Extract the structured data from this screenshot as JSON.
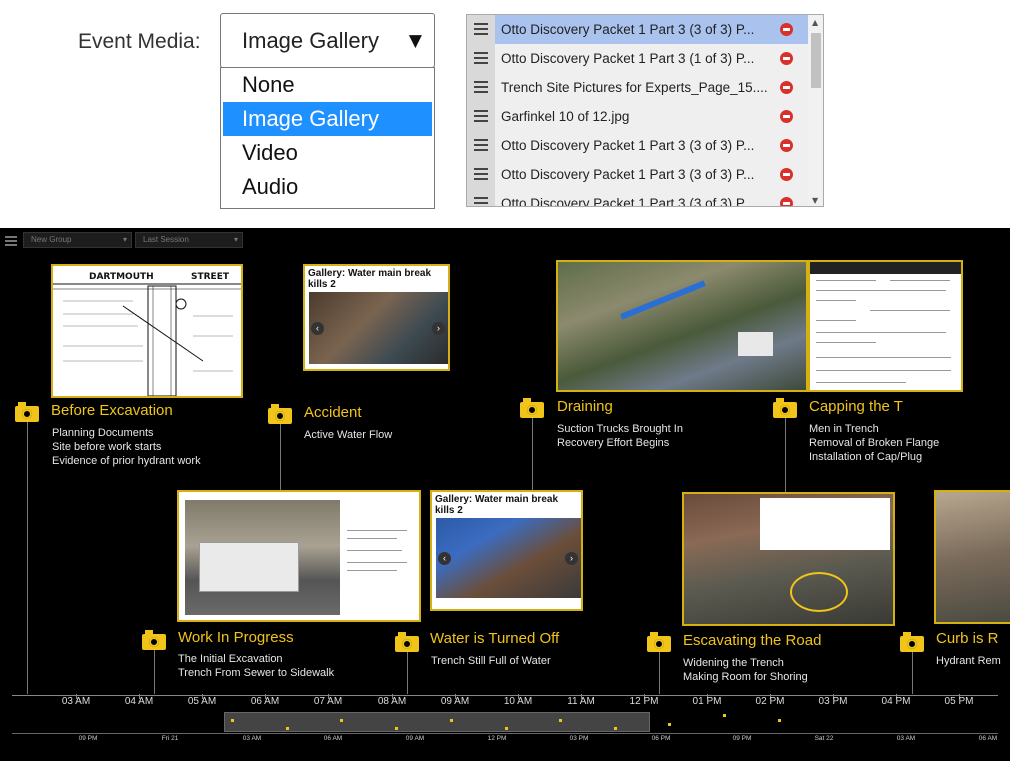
{
  "form": {
    "event_media_label": "Event Media:",
    "selected": "Image Gallery",
    "options": [
      "None",
      "Image Gallery",
      "Video",
      "Audio"
    ]
  },
  "media_list": [
    {
      "name": "Otto Discovery Packet 1 Part 3 (3 of 3) P...",
      "active": true
    },
    {
      "name": "Otto Discovery Packet 1 Part 3 (1 of 3) P..."
    },
    {
      "name": "Trench Site Pictures for Experts_Page_15...."
    },
    {
      "name": "Garfinkel 10 of 12.jpg"
    },
    {
      "name": "Otto Discovery Packet 1 Part 3 (3 of 3) P..."
    },
    {
      "name": "Otto Discovery Packet 1 Part 3 (3 of 3) P..."
    },
    {
      "name": "Otto Discovery Packet 1 Part 3 (3 of 3) P..."
    }
  ],
  "timeline": {
    "group_select": "New Group",
    "session_select": "Last Session",
    "events": [
      {
        "title": "Before Excavation",
        "lines": [
          "Planning Documents",
          "Site before work starts",
          "Evidence of prior hydrant work"
        ]
      },
      {
        "title": "Accident",
        "lines": [
          "Active Water Flow"
        ]
      },
      {
        "title": "Draining",
        "lines": [
          "Suction Trucks Brought In",
          "Recovery Effort Begins"
        ]
      },
      {
        "title": "Capping the T",
        "lines": [
          "Men in Trench",
          "Removal of Broken Flange",
          "Installation of Cap/Plug"
        ]
      },
      {
        "title": "Work In Progress",
        "lines": [
          "The Initial Excavation",
          "Trench From Sewer to Sidewalk"
        ]
      },
      {
        "title": "Water is Turned Off",
        "lines": [
          "Trench Still Full of Water"
        ]
      },
      {
        "title": "Escavating the Road",
        "lines": [
          "Widening the Trench",
          "Making Room for Shoring"
        ]
      },
      {
        "title": "Curb is R",
        "lines": [
          "Hydrant Rem"
        ]
      }
    ],
    "gallery_titles": [
      "Gallery: Water main break kills 2",
      "Gallery: Water main break kills 2"
    ],
    "map_street_label": "DARTMOUTH",
    "map_street_label2": "STREET",
    "axis_ticks": [
      "03 AM",
      "04 AM",
      "05 AM",
      "06 AM",
      "07 AM",
      "08 AM",
      "09 AM",
      "10 AM",
      "11 AM",
      "12 PM",
      "01 PM",
      "02 PM",
      "03 PM",
      "04 PM",
      "05 PM"
    ],
    "overview_ticks": [
      "09 PM",
      "Fri 21",
      "03 AM",
      "06 AM",
      "09 AM",
      "12 PM",
      "03 PM",
      "06 PM",
      "09 PM",
      "Sat 22",
      "03 AM",
      "06 AM"
    ]
  }
}
